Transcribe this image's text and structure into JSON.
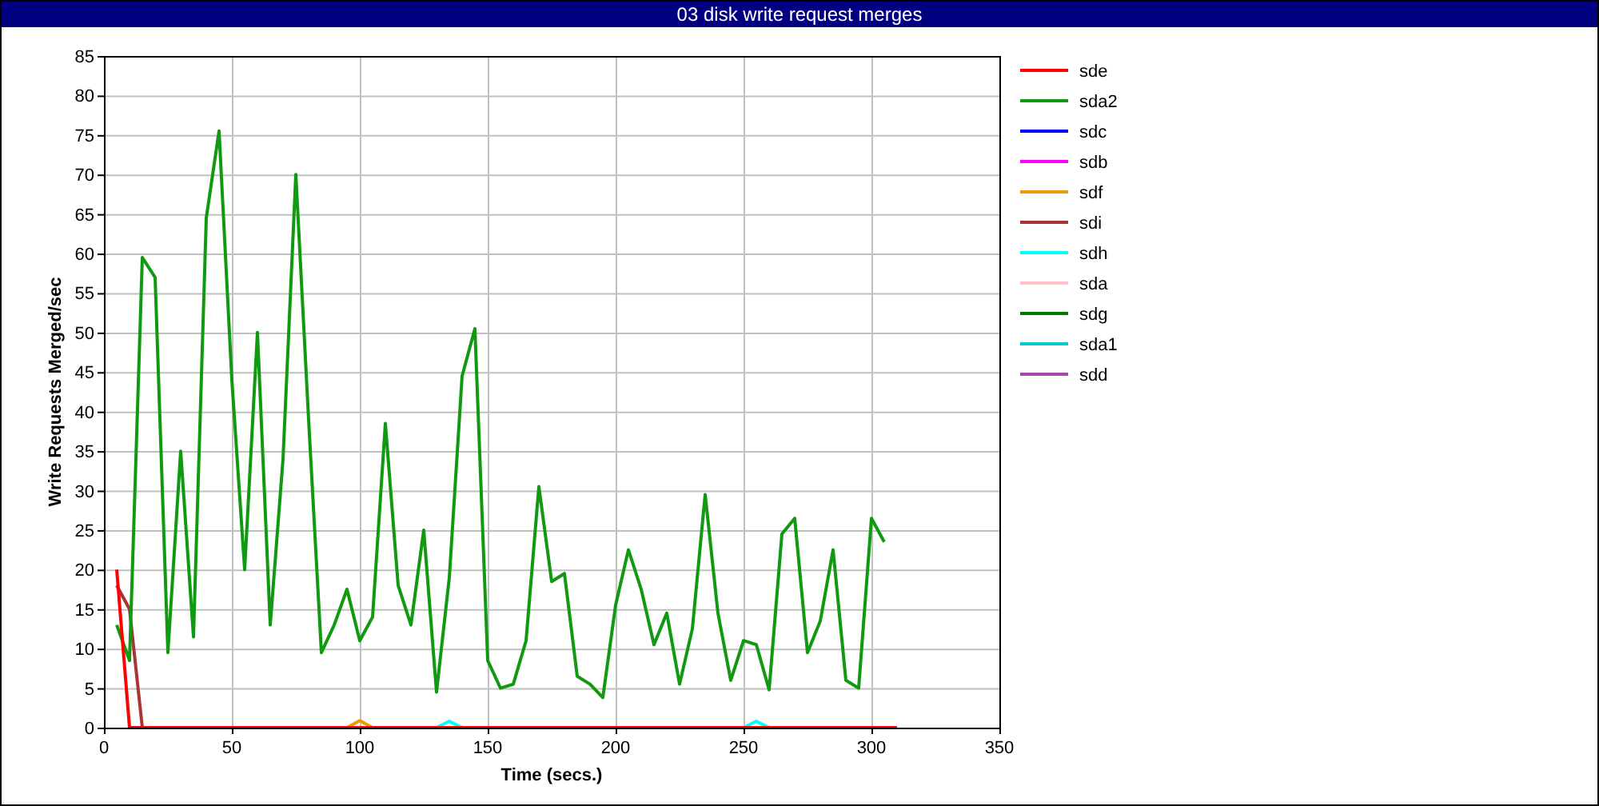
{
  "window": {
    "title": "03 disk write request merges"
  },
  "chart": {
    "chart_data": {
      "type": "line",
      "xlabel": "Time (secs.)",
      "ylabel": "Write Requests Merged/sec",
      "xlim": [
        0,
        350
      ],
      "ylim": [
        0,
        85
      ],
      "grid": true,
      "legend": true,
      "xticks": [
        0,
        50,
        100,
        150,
        200,
        250,
        300,
        350
      ],
      "yticks": [
        0,
        5,
        10,
        15,
        20,
        25,
        30,
        35,
        40,
        45,
        50,
        55,
        60,
        65,
        70,
        75,
        80,
        85
      ],
      "x": [
        5,
        10,
        15,
        20,
        25,
        30,
        35,
        40,
        45,
        50,
        55,
        60,
        65,
        70,
        75,
        80,
        85,
        90,
        95,
        100,
        105,
        110,
        115,
        120,
        125,
        130,
        135,
        140,
        145,
        150,
        155,
        160,
        165,
        170,
        175,
        180,
        185,
        190,
        195,
        200,
        205,
        210,
        215,
        220,
        225,
        230,
        235,
        240,
        245,
        250,
        255,
        260,
        265,
        270,
        275,
        280,
        285,
        290,
        295,
        300,
        305,
        310
      ],
      "series": [
        {
          "name": "sde",
          "color": "#ff0000",
          "values": [
            20,
            0,
            0,
            0,
            0,
            0,
            0,
            0,
            0,
            0,
            0,
            0,
            0,
            0,
            0,
            0,
            0,
            0,
            0,
            0,
            0,
            0,
            0,
            0,
            0,
            0,
            0,
            0,
            0,
            0,
            0,
            0,
            0,
            0,
            0,
            0,
            0,
            0,
            0,
            0,
            0,
            0,
            0,
            0,
            0,
            0,
            0,
            0,
            0,
            0,
            0,
            0,
            0,
            0,
            0,
            0,
            0,
            0,
            0,
            0,
            0,
            0
          ]
        },
        {
          "name": "sda2",
          "color": "#119911",
          "values": [
            13,
            8.5,
            59.5,
            57,
            9.5,
            35,
            11.5,
            64.5,
            75.5,
            44,
            20,
            50,
            13,
            34,
            70,
            39,
            9.5,
            13,
            17.5,
            11,
            14,
            38.5,
            18,
            13,
            25,
            4.5,
            19,
            44.5,
            50.5,
            8.5,
            5,
            5.5,
            11,
            30.5,
            18.5,
            19.5,
            6.5,
            5.5,
            3.8,
            15.5,
            22.5,
            17.5,
            10.5,
            14.5,
            5.5,
            12.5,
            29.5,
            14.5,
            6,
            11,
            10.5,
            4.8,
            24.5,
            26.5,
            9.5,
            13.5,
            22.5,
            6,
            5,
            26.5,
            23.5,
            null
          ]
        },
        {
          "name": "sdc",
          "color": "#0000ff",
          "values": [
            null,
            null,
            null,
            null,
            null,
            null,
            null,
            null,
            null,
            null,
            null,
            null,
            null,
            null,
            null,
            null,
            null,
            null,
            null,
            null,
            null,
            null,
            null,
            null,
            null,
            null,
            null,
            null,
            null,
            null,
            null,
            null,
            null,
            null,
            null,
            null,
            null,
            null,
            null,
            null,
            null,
            null,
            null,
            null,
            null,
            null,
            null,
            null,
            null,
            null,
            null,
            null,
            null,
            null,
            null,
            null,
            null,
            null,
            null,
            null,
            null,
            null
          ]
        },
        {
          "name": "sdb",
          "color": "#ff00ff",
          "values": [
            null,
            null,
            null,
            null,
            null,
            null,
            null,
            null,
            null,
            null,
            null,
            null,
            null,
            null,
            null,
            null,
            null,
            null,
            null,
            null,
            null,
            null,
            null,
            null,
            null,
            null,
            null,
            null,
            null,
            null,
            null,
            null,
            null,
            null,
            null,
            null,
            null,
            null,
            null,
            null,
            null,
            null,
            null,
            null,
            null,
            null,
            null,
            null,
            null,
            null,
            null,
            null,
            null,
            null,
            null,
            null,
            null,
            null,
            null,
            null,
            null,
            null
          ]
        },
        {
          "name": "sdf",
          "color": "#ee9900",
          "values": [
            null,
            null,
            null,
            null,
            null,
            null,
            null,
            null,
            null,
            null,
            null,
            null,
            null,
            null,
            null,
            null,
            null,
            null,
            0,
            0.9,
            0,
            null,
            null,
            null,
            null,
            null,
            null,
            null,
            null,
            null,
            null,
            null,
            null,
            null,
            null,
            null,
            null,
            null,
            null,
            null,
            null,
            null,
            null,
            null,
            null,
            null,
            null,
            null,
            null,
            null,
            null,
            null,
            null,
            null,
            null,
            null,
            null,
            null,
            null,
            null,
            null,
            null
          ]
        },
        {
          "name": "sdi",
          "color": "#aa3333",
          "values": [
            18,
            15,
            0,
            null,
            null,
            null,
            null,
            null,
            null,
            null,
            null,
            null,
            null,
            null,
            null,
            null,
            null,
            null,
            null,
            null,
            null,
            null,
            null,
            null,
            null,
            null,
            null,
            null,
            null,
            null,
            null,
            null,
            null,
            null,
            null,
            null,
            null,
            null,
            null,
            null,
            null,
            null,
            null,
            null,
            null,
            null,
            null,
            null,
            null,
            null,
            null,
            null,
            null,
            null,
            null,
            null,
            null,
            null,
            null,
            null,
            null,
            null
          ]
        },
        {
          "name": "sdh",
          "color": "#00ffff",
          "values": [
            null,
            null,
            null,
            null,
            null,
            null,
            null,
            null,
            null,
            null,
            null,
            null,
            null,
            null,
            null,
            null,
            null,
            null,
            null,
            null,
            null,
            null,
            null,
            null,
            null,
            0,
            0.8,
            0,
            null,
            null,
            null,
            null,
            null,
            null,
            null,
            null,
            null,
            null,
            null,
            null,
            null,
            null,
            null,
            null,
            null,
            null,
            null,
            null,
            null,
            0,
            0.8,
            0,
            null,
            null,
            null,
            null,
            null,
            null,
            null,
            null,
            null,
            null
          ]
        },
        {
          "name": "sda",
          "color": "#ffc0cb",
          "values": [
            null,
            null,
            null,
            null,
            null,
            null,
            null,
            null,
            null,
            null,
            null,
            null,
            null,
            null,
            null,
            null,
            null,
            null,
            null,
            null,
            null,
            null,
            null,
            null,
            null,
            null,
            null,
            null,
            null,
            null,
            null,
            null,
            null,
            null,
            null,
            null,
            null,
            null,
            null,
            null,
            null,
            null,
            null,
            null,
            null,
            null,
            null,
            null,
            null,
            null,
            null,
            null,
            null,
            null,
            null,
            null,
            null,
            null,
            null,
            null,
            null,
            null
          ]
        },
        {
          "name": "sdg",
          "color": "#007700",
          "values": [
            null,
            null,
            null,
            null,
            null,
            null,
            null,
            null,
            null,
            null,
            null,
            null,
            null,
            null,
            null,
            null,
            null,
            null,
            null,
            null,
            null,
            null,
            null,
            null,
            null,
            null,
            null,
            null,
            null,
            null,
            null,
            null,
            null,
            null,
            null,
            null,
            null,
            null,
            null,
            null,
            null,
            null,
            null,
            null,
            null,
            null,
            null,
            null,
            null,
            null,
            null,
            null,
            null,
            null,
            null,
            null,
            null,
            null,
            null,
            null,
            null,
            null
          ]
        },
        {
          "name": "sda1",
          "color": "#00cccc",
          "values": [
            null,
            null,
            null,
            null,
            null,
            null,
            null,
            null,
            null,
            null,
            null,
            null,
            null,
            null,
            null,
            null,
            null,
            null,
            null,
            null,
            null,
            null,
            null,
            null,
            null,
            null,
            null,
            null,
            null,
            null,
            null,
            null,
            null,
            null,
            null,
            null,
            null,
            null,
            null,
            null,
            null,
            null,
            null,
            null,
            null,
            null,
            null,
            null,
            null,
            null,
            null,
            null,
            null,
            null,
            null,
            null,
            null,
            null,
            null,
            null,
            null,
            null
          ]
        },
        {
          "name": "sdd",
          "color": "#aa44aa",
          "values": [
            null,
            null,
            null,
            null,
            null,
            null,
            null,
            null,
            null,
            null,
            null,
            null,
            null,
            null,
            null,
            null,
            null,
            null,
            null,
            null,
            null,
            null,
            null,
            null,
            null,
            null,
            null,
            null,
            null,
            null,
            null,
            null,
            null,
            null,
            null,
            null,
            null,
            null,
            null,
            null,
            null,
            null,
            null,
            null,
            null,
            null,
            null,
            null,
            null,
            null,
            null,
            null,
            null,
            null,
            null,
            null,
            null,
            null,
            null,
            null,
            null,
            null
          ]
        }
      ]
    }
  }
}
